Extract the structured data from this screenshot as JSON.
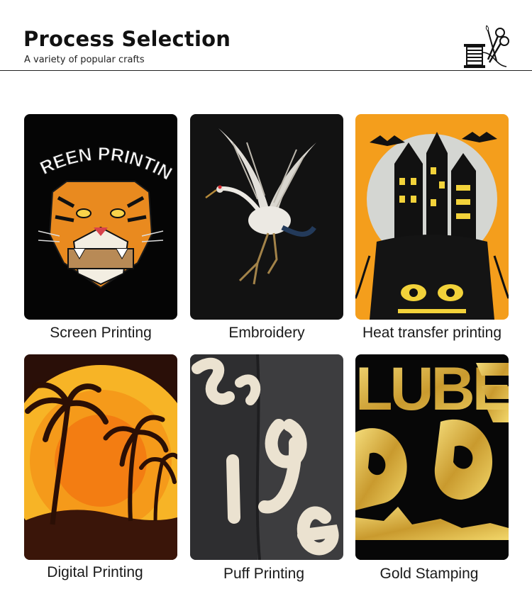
{
  "header": {
    "title": "Process Selection",
    "subtitle": "A variety of popular crafts",
    "logo_icon": "sewing-thread-scissors-icon"
  },
  "crafts": [
    {
      "label": "Screen Printing",
      "art_text": "SCREEN PRINTING"
    },
    {
      "label": "Embroidery"
    },
    {
      "label": "Heat transfer printing"
    },
    {
      "label": "Digital Printing"
    },
    {
      "label": "Puff Printing"
    },
    {
      "label": "Gold Stamping",
      "art_text": "LUBE"
    }
  ],
  "colors": {
    "background": "#ffffff",
    "text": "#111111",
    "shirt_black": "#0b0b0b",
    "orange": "#f5a01a",
    "gold": "#d8b24a",
    "puff_cream": "#e9e0cf"
  }
}
